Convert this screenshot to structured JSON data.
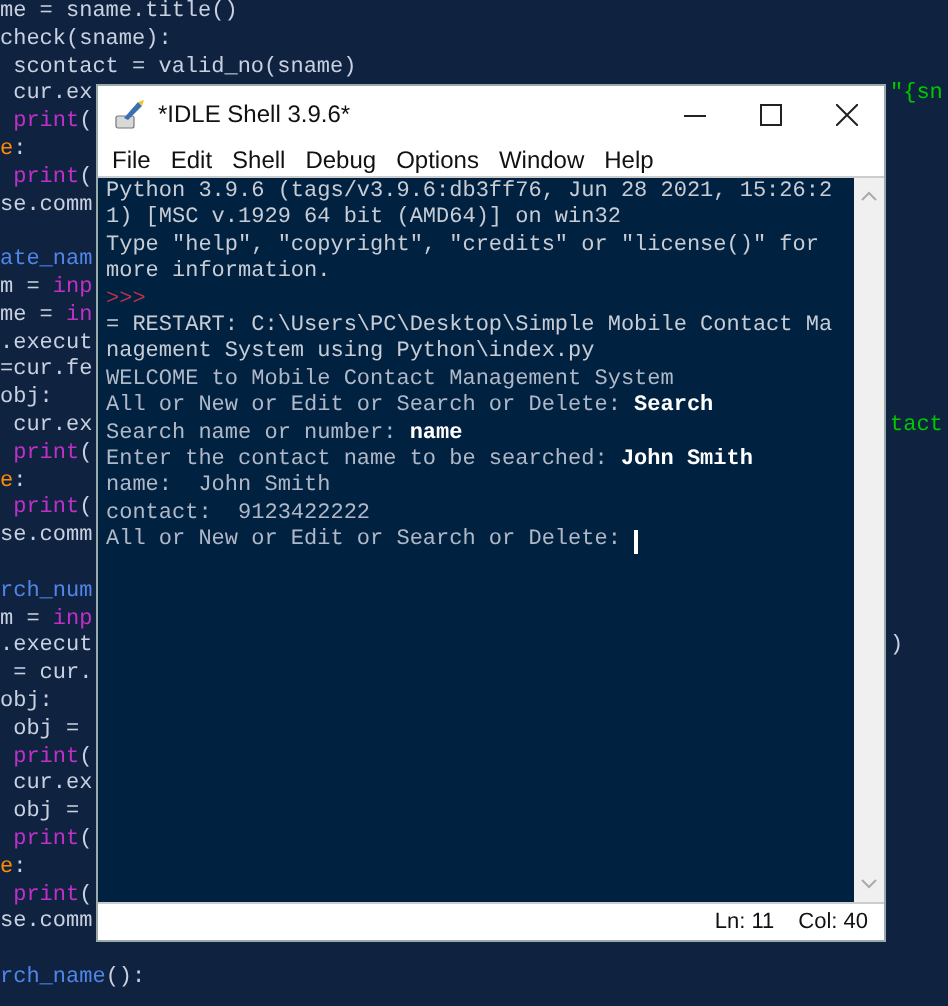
{
  "editor": {
    "lines": [
      {
        "kind": "code",
        "left": [
          {
            "text": "me = sname.title()",
            "kind": "plain"
          }
        ]
      },
      {
        "kind": "code",
        "left": [
          {
            "text": "check(sname):",
            "kind": "plain"
          }
        ]
      },
      {
        "kind": "code",
        "left": [
          {
            "text": " scontact = valid_no(sname)",
            "kind": "plain"
          }
        ]
      },
      {
        "kind": "code",
        "left": [
          {
            "text": " cur.ex",
            "kind": "plain"
          }
        ],
        "right": [
          {
            "text": "\"{sn",
            "kind": "string"
          }
        ]
      },
      {
        "kind": "code",
        "left": [
          {
            "text": " print",
            "kind": "builtin"
          },
          {
            "text": "(",
            "kind": "plain"
          }
        ]
      },
      {
        "kind": "code",
        "left": [
          {
            "text": "e",
            "kind": "keyword"
          },
          {
            "text": ":",
            "kind": "plain"
          }
        ]
      },
      {
        "kind": "code",
        "left": [
          {
            "text": " print",
            "kind": "builtin"
          },
          {
            "text": "(",
            "kind": "plain"
          }
        ]
      },
      {
        "kind": "code",
        "left": [
          {
            "text": "se.comm",
            "kind": "plain"
          }
        ]
      },
      {
        "kind": "blank"
      },
      {
        "kind": "code",
        "left": [
          {
            "text": "ate_nam",
            "kind": "def"
          }
        ]
      },
      {
        "kind": "code",
        "left": [
          {
            "text": "m = ",
            "kind": "plain"
          },
          {
            "text": "inp",
            "kind": "builtin"
          }
        ]
      },
      {
        "kind": "code",
        "left": [
          {
            "text": "me = ",
            "kind": "plain"
          },
          {
            "text": "in",
            "kind": "builtin"
          }
        ]
      },
      {
        "kind": "code",
        "left": [
          {
            "text": ".execut",
            "kind": "plain"
          }
        ]
      },
      {
        "kind": "code",
        "left": [
          {
            "text": "=cur.fe",
            "kind": "plain"
          }
        ]
      },
      {
        "kind": "code",
        "left": [
          {
            "text": "obj:",
            "kind": "plain"
          }
        ]
      },
      {
        "kind": "code",
        "left": [
          {
            "text": " cur.ex",
            "kind": "plain"
          }
        ],
        "right": [
          {
            "text": "tact",
            "kind": "string"
          }
        ]
      },
      {
        "kind": "code",
        "left": [
          {
            "text": " print",
            "kind": "builtin"
          },
          {
            "text": "(",
            "kind": "plain"
          }
        ]
      },
      {
        "kind": "code",
        "left": [
          {
            "text": "e",
            "kind": "keyword"
          },
          {
            "text": ":",
            "kind": "plain"
          }
        ]
      },
      {
        "kind": "code",
        "left": [
          {
            "text": " print",
            "kind": "builtin"
          },
          {
            "text": "(",
            "kind": "plain"
          }
        ]
      },
      {
        "kind": "code",
        "left": [
          {
            "text": "se.comm",
            "kind": "plain"
          }
        ]
      },
      {
        "kind": "blank"
      },
      {
        "kind": "code",
        "left": [
          {
            "text": "rch_num",
            "kind": "def"
          }
        ]
      },
      {
        "kind": "code",
        "left": [
          {
            "text": "m = ",
            "kind": "plain"
          },
          {
            "text": "inp",
            "kind": "builtin"
          }
        ]
      },
      {
        "kind": "code",
        "left": [
          {
            "text": ".execut",
            "kind": "plain"
          }
        ],
        "right": [
          {
            "text": ")",
            "kind": "plain"
          }
        ]
      },
      {
        "kind": "code",
        "left": [
          {
            "text": " = cur.",
            "kind": "plain"
          }
        ]
      },
      {
        "kind": "code",
        "left": [
          {
            "text": "obj:",
            "kind": "plain"
          }
        ]
      },
      {
        "kind": "code",
        "left": [
          {
            "text": " obj =",
            "kind": "plain"
          }
        ]
      },
      {
        "kind": "code",
        "left": [
          {
            "text": " print",
            "kind": "builtin"
          },
          {
            "text": "(",
            "kind": "plain"
          }
        ]
      },
      {
        "kind": "code",
        "left": [
          {
            "text": " cur.ex",
            "kind": "plain"
          }
        ]
      },
      {
        "kind": "code",
        "left": [
          {
            "text": " obj =",
            "kind": "plain"
          }
        ]
      },
      {
        "kind": "code",
        "left": [
          {
            "text": " print",
            "kind": "builtin"
          },
          {
            "text": "(",
            "kind": "plain"
          }
        ]
      },
      {
        "kind": "code",
        "left": [
          {
            "text": "e",
            "kind": "keyword"
          },
          {
            "text": ":",
            "kind": "plain"
          }
        ]
      },
      {
        "kind": "code",
        "left": [
          {
            "text": " print",
            "kind": "builtin"
          },
          {
            "text": "(",
            "kind": "plain"
          }
        ]
      },
      {
        "kind": "code",
        "left": [
          {
            "text": "se.comm",
            "kind": "plain"
          }
        ]
      },
      {
        "kind": "blank"
      },
      {
        "kind": "code",
        "left": [
          {
            "text": "rch_name",
            "kind": "def"
          },
          {
            "text": "():",
            "kind": "plain"
          }
        ]
      }
    ]
  },
  "window": {
    "title": "*IDLE Shell 3.9.6*",
    "menu": [
      "File",
      "Edit",
      "Shell",
      "Debug",
      "Options",
      "Window",
      "Help"
    ],
    "shell": {
      "lines": [
        [
          {
            "text": "Python 3.9.6 (tags/v3.9.6:db3ff76, Jun 28 2021, 15:26:2",
            "kind": "output"
          }
        ],
        [
          {
            "text": "1) [MSC v.1929 64 bit (AMD64)] on win32",
            "kind": "output"
          }
        ],
        [
          {
            "text": "Type \"help\", \"copyright\", \"credits\" or \"license()\" for",
            "kind": "output"
          }
        ],
        [
          {
            "text": "more information.",
            "kind": "output"
          }
        ],
        [
          {
            "text": ">>>",
            "kind": "prompt"
          }
        ],
        [
          {
            "text": "= RESTART: C:\\Users\\PC\\Desktop\\Simple Mobile Contact Ma",
            "kind": "output"
          }
        ],
        [
          {
            "text": "nagement System using Python\\index.py",
            "kind": "output"
          }
        ],
        [
          {
            "text": "WELCOME to Mobile Contact Management System",
            "kind": "stdout"
          }
        ],
        [
          {
            "text": "All or New or Edit or Search or Delete: ",
            "kind": "stdout"
          },
          {
            "text": "Search",
            "kind": "input"
          }
        ],
        [
          {
            "text": "Search name or number: ",
            "kind": "stdout"
          },
          {
            "text": "name",
            "kind": "input"
          }
        ],
        [
          {
            "text": "Enter the contact name to be searched: ",
            "kind": "stdout"
          },
          {
            "text": "John Smith",
            "kind": "input"
          }
        ],
        [
          {
            "text": "name:  John Smith",
            "kind": "stdout"
          }
        ],
        [
          {
            "text": "contact:  9123422222",
            "kind": "stdout"
          }
        ],
        [
          {
            "text": "All or New or Edit or Search or Delete: ",
            "kind": "stdout"
          }
        ]
      ]
    },
    "status_bar": {
      "line": "Ln: 11",
      "column": "Col: 40"
    }
  }
}
